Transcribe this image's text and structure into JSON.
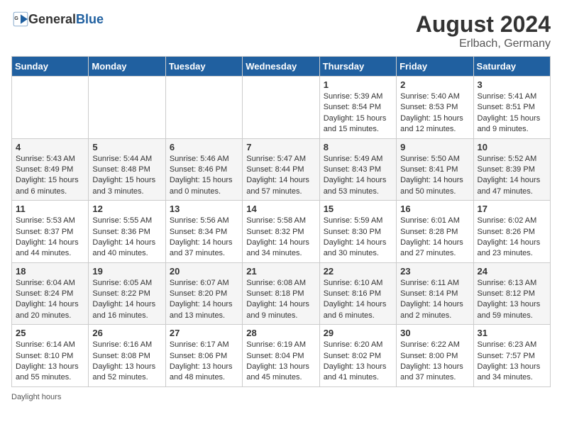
{
  "header": {
    "logo_general": "General",
    "logo_blue": "Blue",
    "month_year": "August 2024",
    "location": "Erlbach, Germany"
  },
  "weekdays": [
    "Sunday",
    "Monday",
    "Tuesday",
    "Wednesday",
    "Thursday",
    "Friday",
    "Saturday"
  ],
  "weeks": [
    [
      {
        "day": "",
        "info": ""
      },
      {
        "day": "",
        "info": ""
      },
      {
        "day": "",
        "info": ""
      },
      {
        "day": "",
        "info": ""
      },
      {
        "day": "1",
        "info": "Sunrise: 5:39 AM\nSunset: 8:54 PM\nDaylight: 15 hours and 15 minutes."
      },
      {
        "day": "2",
        "info": "Sunrise: 5:40 AM\nSunset: 8:53 PM\nDaylight: 15 hours and 12 minutes."
      },
      {
        "day": "3",
        "info": "Sunrise: 5:41 AM\nSunset: 8:51 PM\nDaylight: 15 hours and 9 minutes."
      }
    ],
    [
      {
        "day": "4",
        "info": "Sunrise: 5:43 AM\nSunset: 8:49 PM\nDaylight: 15 hours and 6 minutes."
      },
      {
        "day": "5",
        "info": "Sunrise: 5:44 AM\nSunset: 8:48 PM\nDaylight: 15 hours and 3 minutes."
      },
      {
        "day": "6",
        "info": "Sunrise: 5:46 AM\nSunset: 8:46 PM\nDaylight: 15 hours and 0 minutes."
      },
      {
        "day": "7",
        "info": "Sunrise: 5:47 AM\nSunset: 8:44 PM\nDaylight: 14 hours and 57 minutes."
      },
      {
        "day": "8",
        "info": "Sunrise: 5:49 AM\nSunset: 8:43 PM\nDaylight: 14 hours and 53 minutes."
      },
      {
        "day": "9",
        "info": "Sunrise: 5:50 AM\nSunset: 8:41 PM\nDaylight: 14 hours and 50 minutes."
      },
      {
        "day": "10",
        "info": "Sunrise: 5:52 AM\nSunset: 8:39 PM\nDaylight: 14 hours and 47 minutes."
      }
    ],
    [
      {
        "day": "11",
        "info": "Sunrise: 5:53 AM\nSunset: 8:37 PM\nDaylight: 14 hours and 44 minutes."
      },
      {
        "day": "12",
        "info": "Sunrise: 5:55 AM\nSunset: 8:36 PM\nDaylight: 14 hours and 40 minutes."
      },
      {
        "day": "13",
        "info": "Sunrise: 5:56 AM\nSunset: 8:34 PM\nDaylight: 14 hours and 37 minutes."
      },
      {
        "day": "14",
        "info": "Sunrise: 5:58 AM\nSunset: 8:32 PM\nDaylight: 14 hours and 34 minutes."
      },
      {
        "day": "15",
        "info": "Sunrise: 5:59 AM\nSunset: 8:30 PM\nDaylight: 14 hours and 30 minutes."
      },
      {
        "day": "16",
        "info": "Sunrise: 6:01 AM\nSunset: 8:28 PM\nDaylight: 14 hours and 27 minutes."
      },
      {
        "day": "17",
        "info": "Sunrise: 6:02 AM\nSunset: 8:26 PM\nDaylight: 14 hours and 23 minutes."
      }
    ],
    [
      {
        "day": "18",
        "info": "Sunrise: 6:04 AM\nSunset: 8:24 PM\nDaylight: 14 hours and 20 minutes."
      },
      {
        "day": "19",
        "info": "Sunrise: 6:05 AM\nSunset: 8:22 PM\nDaylight: 14 hours and 16 minutes."
      },
      {
        "day": "20",
        "info": "Sunrise: 6:07 AM\nSunset: 8:20 PM\nDaylight: 14 hours and 13 minutes."
      },
      {
        "day": "21",
        "info": "Sunrise: 6:08 AM\nSunset: 8:18 PM\nDaylight: 14 hours and 9 minutes."
      },
      {
        "day": "22",
        "info": "Sunrise: 6:10 AM\nSunset: 8:16 PM\nDaylight: 14 hours and 6 minutes."
      },
      {
        "day": "23",
        "info": "Sunrise: 6:11 AM\nSunset: 8:14 PM\nDaylight: 14 hours and 2 minutes."
      },
      {
        "day": "24",
        "info": "Sunrise: 6:13 AM\nSunset: 8:12 PM\nDaylight: 13 hours and 59 minutes."
      }
    ],
    [
      {
        "day": "25",
        "info": "Sunrise: 6:14 AM\nSunset: 8:10 PM\nDaylight: 13 hours and 55 minutes."
      },
      {
        "day": "26",
        "info": "Sunrise: 6:16 AM\nSunset: 8:08 PM\nDaylight: 13 hours and 52 minutes."
      },
      {
        "day": "27",
        "info": "Sunrise: 6:17 AM\nSunset: 8:06 PM\nDaylight: 13 hours and 48 minutes."
      },
      {
        "day": "28",
        "info": "Sunrise: 6:19 AM\nSunset: 8:04 PM\nDaylight: 13 hours and 45 minutes."
      },
      {
        "day": "29",
        "info": "Sunrise: 6:20 AM\nSunset: 8:02 PM\nDaylight: 13 hours and 41 minutes."
      },
      {
        "day": "30",
        "info": "Sunrise: 6:22 AM\nSunset: 8:00 PM\nDaylight: 13 hours and 37 minutes."
      },
      {
        "day": "31",
        "info": "Sunrise: 6:23 AM\nSunset: 7:57 PM\nDaylight: 13 hours and 34 minutes."
      }
    ]
  ],
  "footer": {
    "daylight_label": "Daylight hours"
  }
}
